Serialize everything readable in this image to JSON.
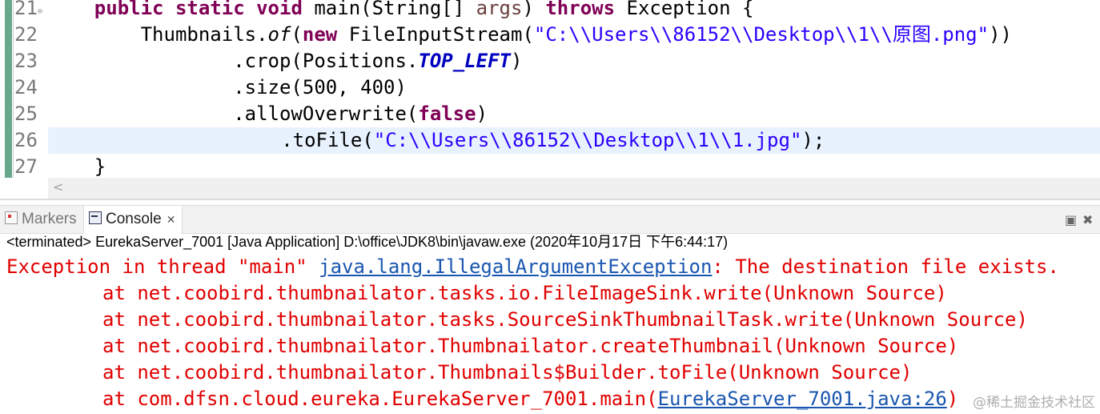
{
  "editor": {
    "lines": [
      {
        "num": "21",
        "tokens": [
          {
            "t": "    "
          },
          {
            "t": "public",
            "c": "kw"
          },
          {
            "t": " "
          },
          {
            "t": "static",
            "c": "kw"
          },
          {
            "t": " "
          },
          {
            "t": "void",
            "c": "kw"
          },
          {
            "t": " main(String[] "
          },
          {
            "t": "args",
            "c": "param"
          },
          {
            "t": ") "
          },
          {
            "t": "throws",
            "c": "kw"
          },
          {
            "t": " Exception {"
          }
        ]
      },
      {
        "num": "22",
        "tokens": [
          {
            "t": "        Thumbnails."
          },
          {
            "t": "of",
            "c": "ital"
          },
          {
            "t": "("
          },
          {
            "t": "new",
            "c": "kw"
          },
          {
            "t": " FileInputStream("
          },
          {
            "t": "\"C:\\\\Users\\\\86152\\\\Desktop\\\\1\\\\原图.png\"",
            "c": "str"
          },
          {
            "t": "))"
          }
        ]
      },
      {
        "num": "23",
        "tokens": [
          {
            "t": "                .crop(Positions."
          },
          {
            "t": "TOP_LEFT",
            "c": "field"
          },
          {
            "t": ")"
          }
        ]
      },
      {
        "num": "24",
        "tokens": [
          {
            "t": "                .size(500, 400)"
          }
        ]
      },
      {
        "num": "25",
        "tokens": [
          {
            "t": "                .allowOverwrite("
          },
          {
            "t": "false",
            "c": "kw"
          },
          {
            "t": ")"
          }
        ]
      },
      {
        "num": "26",
        "tokens": [
          {
            "t": "                .toFile("
          },
          {
            "t": "\"C:\\\\Users\\\\86152\\\\Desktop\\\\1\\\\1.jpg\"",
            "c": "str"
          },
          {
            "t": ");"
          }
        ]
      },
      {
        "num": "27",
        "tokens": [
          {
            "t": "    }"
          }
        ]
      }
    ],
    "current_line": "26",
    "fold_marker": "⊖",
    "scroll_left": "<"
  },
  "views": {
    "tabs": [
      {
        "label": "Markers",
        "icon": "markers-icon"
      },
      {
        "label": "Console",
        "icon": "console-icon",
        "close": "✕"
      }
    ],
    "minimize": "▣",
    "close_view": "✖",
    "status": "<terminated> EurekaServer_7001 [Java Application] D:\\office\\JDK8\\bin\\javaw.exe (2020年10月17日 下午6:44:17)",
    "exception": {
      "prefix": "Exception in thread \"main\" ",
      "link": "java.lang.IllegalArgumentException",
      "message": ": The destination file exists."
    },
    "stack": [
      {
        "text": "at net.coobird.thumbnailator.tasks.io.FileImageSink.write(Unknown Source)"
      },
      {
        "text": "at net.coobird.thumbnailator.tasks.SourceSinkThumbnailTask.write(Unknown Source)"
      },
      {
        "text": "at net.coobird.thumbnailator.Thumbnailator.createThumbnail(Unknown Source)"
      },
      {
        "text": "at net.coobird.thumbnailator.Thumbnails$Builder.toFile(Unknown Source)"
      },
      {
        "text": "at com.dfsn.cloud.eureka.EurekaServer_7001.main(",
        "link": "EurekaServer_7001.java:26",
        "suffix": ")"
      }
    ],
    "watermark": "@稀土掘金技术社区"
  }
}
